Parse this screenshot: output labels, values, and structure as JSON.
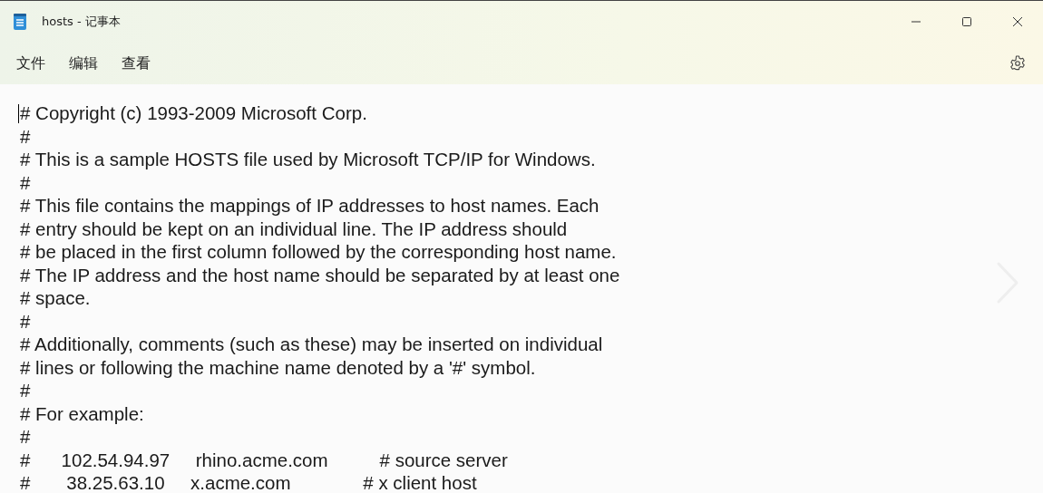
{
  "window": {
    "title": "hosts - 记事本"
  },
  "menu": [
    "文件",
    "编辑",
    "查看"
  ],
  "lines": [
    "# Copyright (c) 1993-2009 Microsoft Corp.",
    "#",
    "# This is a sample HOSTS file used by Microsoft TCP/IP for Windows.",
    "#",
    "# This file contains the mappings of IP addresses to host names. Each",
    "# entry should be kept on an individual line. The IP address should",
    "# be placed in the first column followed by the corresponding host name.",
    "# The IP address and the host name should be separated by at least one",
    "# space.",
    "#",
    "# Additionally, comments (such as these) may be inserted on individual",
    "# lines or following the machine name denoted by a '#' symbol.",
    "#",
    "# For example:",
    "#",
    "#      102.54.94.97     rhino.acme.com          # source server",
    "#       38.25.63.10     x.acme.com              # x client host"
  ]
}
